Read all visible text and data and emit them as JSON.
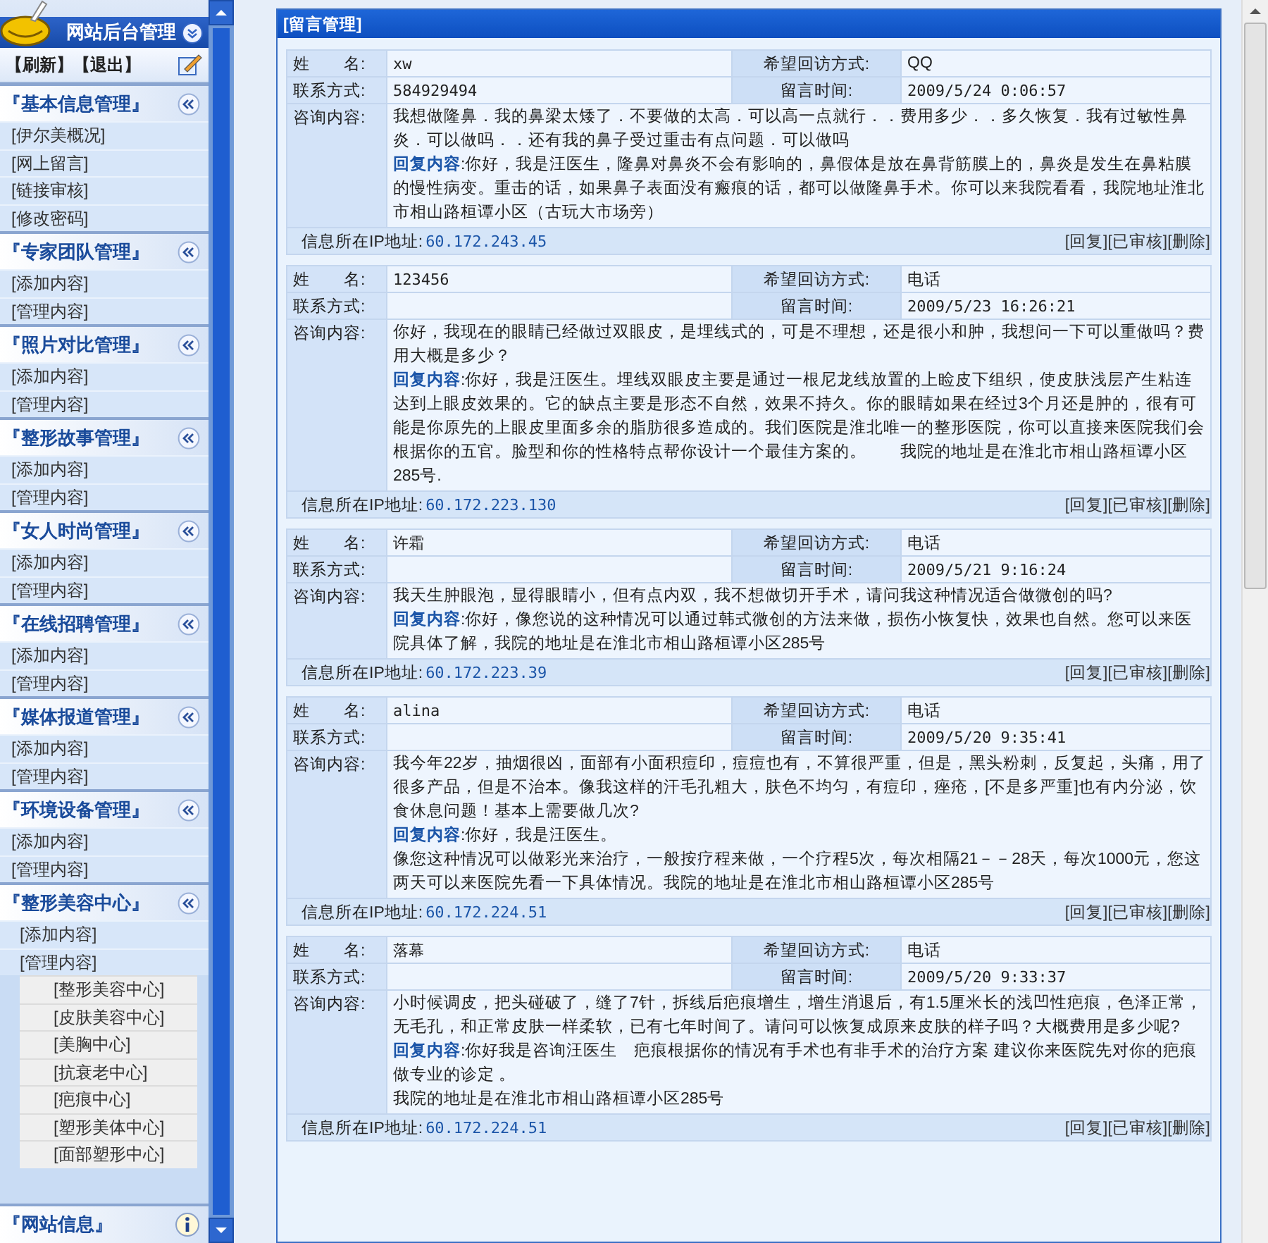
{
  "sidebar": {
    "title": "网站后台管理",
    "toolbar": [
      "【刷新】",
      "【退出】"
    ],
    "sections": [
      {
        "title": "『基本信息管理』",
        "expanded": true,
        "items": [
          {
            "label": "[伊尔美概况]"
          },
          {
            "label": "[网上留言]"
          },
          {
            "label": "[链接审核]"
          },
          {
            "label": "[修改密码]"
          }
        ]
      },
      {
        "title": "『专家团队管理』",
        "expanded": true,
        "items": [
          {
            "label": "[添加内容]"
          },
          {
            "label": "[管理内容]"
          }
        ]
      },
      {
        "title": "『照片对比管理』",
        "expanded": true,
        "items": [
          {
            "label": "[添加内容]"
          },
          {
            "label": "[管理内容]"
          }
        ]
      },
      {
        "title": "『整形故事管理』",
        "expanded": true,
        "items": [
          {
            "label": "[添加内容]"
          },
          {
            "label": "[管理内容]"
          }
        ]
      },
      {
        "title": "『女人时尚管理』",
        "expanded": true,
        "items": [
          {
            "label": "[添加内容]"
          },
          {
            "label": "[管理内容]"
          }
        ]
      },
      {
        "title": "『在线招聘管理』",
        "expanded": true,
        "items": [
          {
            "label": "[添加内容]"
          },
          {
            "label": "[管理内容]"
          }
        ]
      },
      {
        "title": "『媒体报道管理』",
        "expanded": true,
        "items": [
          {
            "label": "[添加内容]"
          },
          {
            "label": "[管理内容]"
          }
        ]
      },
      {
        "title": "『环境设备管理』",
        "expanded": true,
        "items": [
          {
            "label": "[添加内容]"
          },
          {
            "label": "[管理内容]"
          }
        ]
      },
      {
        "title": "『整形美容中心』",
        "expanded": true,
        "items": [
          {
            "label": "[添加内容]"
          },
          {
            "label": "[管理内容]",
            "children": [
              {
                "label": "[整形美容中心]"
              },
              {
                "label": "[皮肤美容中心]"
              },
              {
                "label": "[美胸中心]"
              },
              {
                "label": "[抗衰老中心]"
              },
              {
                "label": "[疤痕中心]"
              },
              {
                "label": "[塑形美体中心]"
              },
              {
                "label": "[面部塑形中心]"
              }
            ]
          }
        ]
      }
    ],
    "footer": {
      "title": "『网站信息』"
    }
  },
  "panel": {
    "title": "[留言管理]",
    "records": [
      {
        "name_label": "姓　　名:",
        "name": "xw",
        "callback_label": "希望回访方式:",
        "callback": "QQ",
        "contact_label": "联系方式:",
        "contact": "584929494",
        "time_label": "留言时间:",
        "time": "2009/5/24 0:06:57",
        "question_label": "咨询内容:",
        "question": "我想做隆鼻．我的鼻梁太矮了．不要做的太高．可以高一点就行．．费用多少．．多久恢复．我有过敏性鼻炎．可以做吗．．还有我的鼻子受过重击有点问题．可以做吗",
        "reply_label": "回复内容",
        "reply": [
          ":你好，我是汪医生，隆鼻对鼻炎不会有影响的，鼻假体是放在鼻背筋膜上的，鼻炎是发生在鼻粘膜的慢性病变。重击的话，如果鼻子表面没有瘢痕的话，都可以做隆鼻手术。你可以来我院看看，我院地址淮北市相山路桓谭小区（古玩大市场旁）"
        ],
        "ip_label": "信息所在IP地址:",
        "ip": "60.172.243.45",
        "actions": [
          "[回复]",
          "[已审核]",
          "[删除]"
        ]
      },
      {
        "name_label": "姓　　名:",
        "name": "123456",
        "callback_label": "希望回访方式:",
        "callback": "电话",
        "contact_label": "联系方式:",
        "time_label": "留言时间:",
        "time": "2009/5/23 16:26:21",
        "question_label": "咨询内容:",
        "question": "你好，我现在的眼睛已经做过双眼皮，是埋线式的，可是不理想，还是很小和肿，我想问一下可以重做吗？费用大概是多少？",
        "reply_label": "回复内容",
        "reply": [
          ":你好，我是汪医生。埋线双眼皮主要是通过一根尼龙线放置的上睑皮下组织，使皮肤浅层产生粘连达到上眼皮效果的。它的缺点主要是形态不自然，效果不持久。你的眼睛如果在经过3个月还是肿的，很有可能是你原先的上眼皮里面多余的脂肪很多造成的。我们医院是淮北唯一的整形医院，你可以直接来医院我们会根据你的五官。脸型和你的性格特点帮你设计一个最佳方案的。　　我院的地址是在淮北市相山路桓谭小区285号."
        ],
        "ip_label": "信息所在IP地址:",
        "ip": "60.172.223.130",
        "actions": [
          "[回复]",
          "[已审核]",
          "[删除]"
        ]
      },
      {
        "name_label": "姓　　名:",
        "name": "许霜",
        "callback_label": "希望回访方式:",
        "callback": "电话",
        "contact_label": "联系方式:",
        "time_label": "留言时间:",
        "time": "2009/5/21 9:16:24",
        "question_label": "咨询内容:",
        "question": "我天生肿眼泡，显得眼睛小，但有点内双，我不想做切开手术，请问我这种情况适合做微创的吗?",
        "reply_label": "回复内容",
        "reply": [
          ":你好，像您说的这种情况可以通过韩式微创的方法来做，损伤小恢复快，效果也自然。您可以来医院具体了解，我院的地址是在淮北市相山路桓谭小区285号"
        ],
        "ip_label": "信息所在IP地址:",
        "ip": "60.172.223.39",
        "actions": [
          "[回复]",
          "[已审核]",
          "[删除]"
        ]
      },
      {
        "name_label": "姓　　名:",
        "name": "alina",
        "callback_label": "希望回访方式:",
        "callback": "电话",
        "contact_label": "联系方式:",
        "time_label": "留言时间:",
        "time": "2009/5/20 9:35:41",
        "question_label": "咨询内容:",
        "question": "我今年22岁，抽烟很凶，面部有小面积痘印，痘痘也有，不算很严重，但是，黑头粉刺，反复起，头痛，用了很多产品，但是不治本。像我这样的汗毛孔粗大，肤色不均匀，有痘印，痤疮，[不是多严重]也有内分泌，饮食休息问题！基本上需要做几次?",
        "reply_label": "回复内容",
        "reply": [
          ":你好，我是汪医生。",
          "像您这种情况可以做彩光来治疗，一般按疗程来做，一个疗程5次，每次相隔21－－28天，每次1000元，您这两天可以来医院先看一下具体情况。我院的地址是在淮北市相山路桓谭小区285号"
        ],
        "ip_label": "信息所在IP地址:",
        "ip": "60.172.224.51",
        "actions": [
          "[回复]",
          "[已审核]",
          "[删除]"
        ]
      },
      {
        "name_label": "姓　　名:",
        "name": "落幕",
        "callback_label": "希望回访方式:",
        "callback": "电话",
        "contact_label": "联系方式:",
        "time_label": "留言时间:",
        "time": "2009/5/20 9:33:37",
        "question_label": "咨询内容:",
        "question": "小时候调皮，把头碰破了，缝了7针，拆线后疤痕增生，增生消退后，有1.5厘米长的浅凹性疤痕，色泽正常，无毛孔，和正常皮肤一样柔软，已有七年时间了。请问可以恢复成原来皮肤的样子吗？大概费用是多少呢?",
        "reply_label": "回复内容",
        "reply": [
          ":你好我是咨询汪医生　疤痕根据你的情况有手术也有非手术的治疗方案 建议你来医院先对你的疤痕做专业的诊定 。",
          "我院的地址是在淮北市相山路桓谭小区285号"
        ],
        "ip_label": "信息所在IP地址:",
        "ip": "60.172.224.51",
        "actions": [
          "[回复]",
          "[已审核]",
          "[删除]"
        ]
      }
    ]
  }
}
